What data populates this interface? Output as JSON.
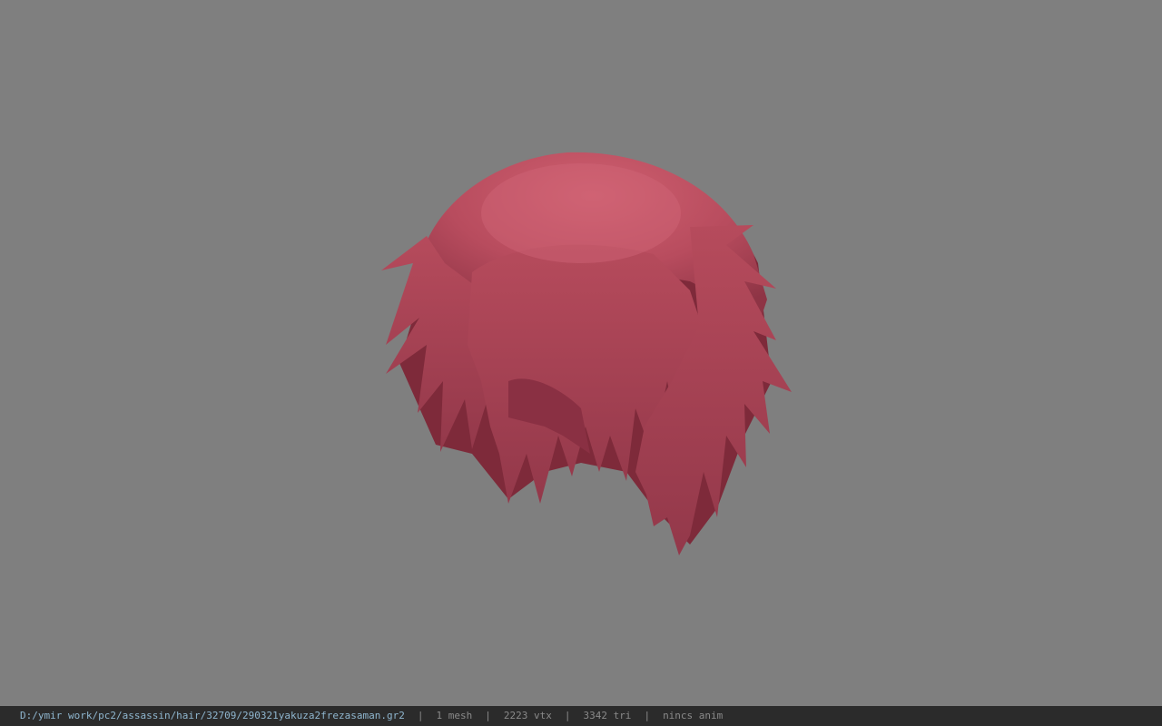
{
  "viewer": {
    "background_color": "#7f7f7f",
    "model": {
      "name": "hair-mesh",
      "color": "#c85a6a",
      "shadow_color": "#7e2a3a"
    }
  },
  "status_bar": {
    "file_path": "D:/ymir work/pc2/assassin/hair/32709/290321yakuza2frezasaman.gr2",
    "separator": "|",
    "mesh_count": "1 mesh",
    "vertex_count": "2223 vtx",
    "triangle_count": "3342 tri",
    "anim_status": "nincs anim"
  }
}
